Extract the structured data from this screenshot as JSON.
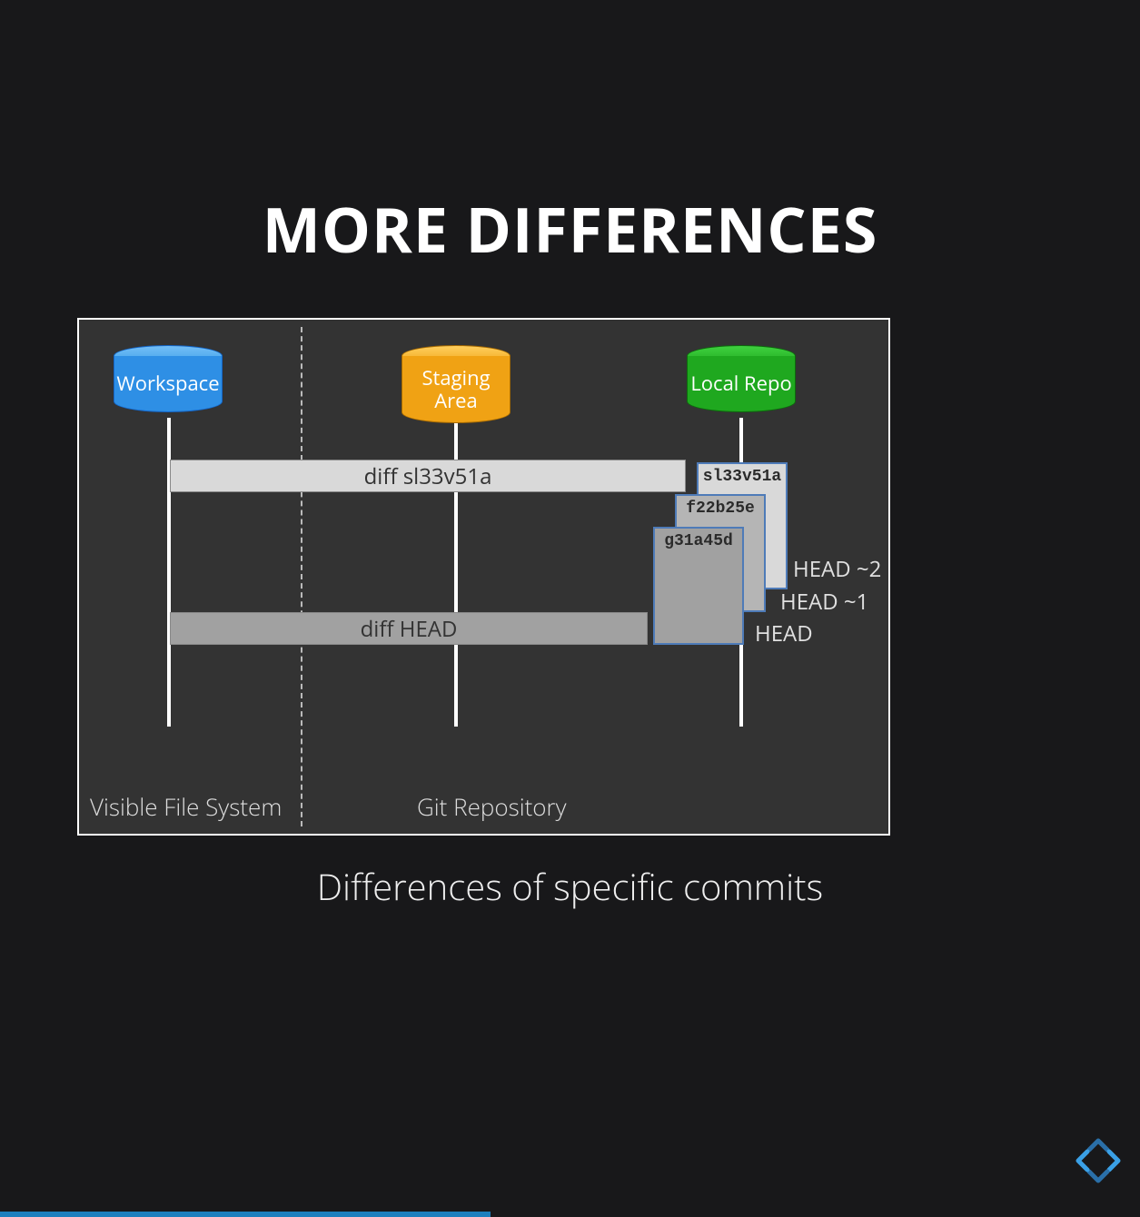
{
  "title": "MORE DIFFERENCES",
  "caption": "Differences of specific commits",
  "sections": {
    "visible": "Visible File System",
    "repo": "Git Repository"
  },
  "stores": {
    "workspace": "Workspace",
    "staging": "Staging\nArea",
    "local": "Local Repo"
  },
  "bars": {
    "diff_sha": "diff sl33v51a",
    "diff_head": "diff HEAD"
  },
  "commits": {
    "c1": "sl33v51a",
    "c2": "f22b25e",
    "c3": "g31a45d"
  },
  "head_labels": {
    "h2": "HEAD ~2",
    "h1": "HEAD ~1",
    "h0": "HEAD"
  },
  "progress_percent": 43
}
